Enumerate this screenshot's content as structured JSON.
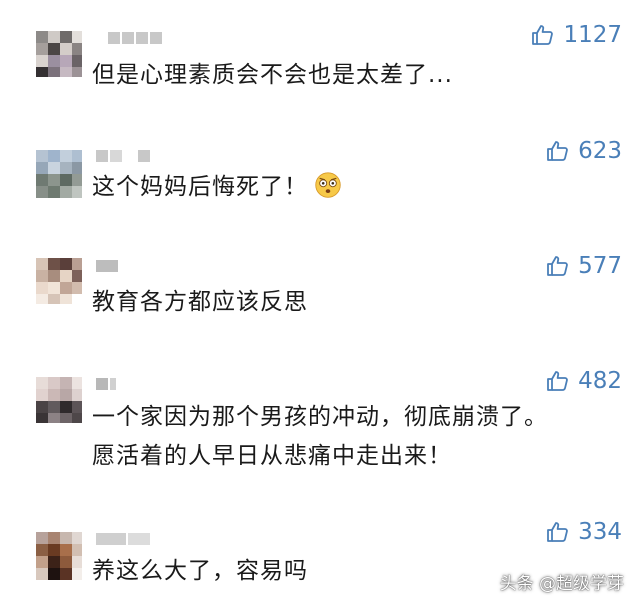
{
  "comments": [
    {
      "text": "但是心理素质会不会也是太差了...",
      "likes": "1127"
    },
    {
      "text": "这个妈妈后悔死了！",
      "likes": "623",
      "emoji": "astonished-face-emoji"
    },
    {
      "text": "教育各方都应该反思",
      "likes": "577"
    },
    {
      "text_line1": "一个家因为那个男孩的冲动，彻底崩溃了。",
      "text_line2": "愿活着的人早日从悲痛中走出来！",
      "likes": "482"
    },
    {
      "text": "养这么大了，容易吗",
      "likes": "334"
    }
  ],
  "icons": {
    "like": "thumbs-up-icon"
  },
  "colors": {
    "like_accent": "#4a7fb8",
    "text": "#1a1a1a",
    "background": "#ffffff"
  },
  "watermark": "头条 @超级学芽"
}
